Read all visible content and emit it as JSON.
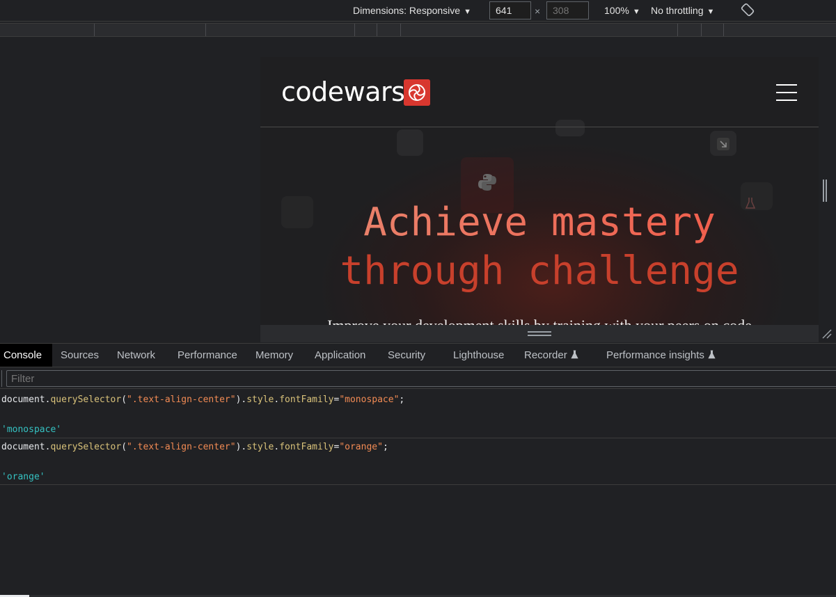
{
  "device_toolbar": {
    "dimensions_label": "Dimensions: Responsive",
    "width_value": "641",
    "height_placeholder": "308",
    "times": "×",
    "zoom": "100%",
    "throttling": "No throttling",
    "caret": "▼"
  },
  "page": {
    "logo_text": "codewars",
    "hero_line1": "Achieve mastery",
    "hero_line2": "through challenge",
    "hero_sub": "Improve your development skills by training with your peers on code",
    "brand_color": "#d8372f"
  },
  "tabs": [
    {
      "label": "Console",
      "active": true
    },
    {
      "label": "Sources"
    },
    {
      "label": "Network"
    },
    {
      "label": "Performance"
    },
    {
      "label": "Memory"
    },
    {
      "label": "Application"
    },
    {
      "label": "Security"
    },
    {
      "label": "Lighthouse"
    },
    {
      "label": "Recorder",
      "experimental": true
    },
    {
      "label": "Performance insights",
      "experimental": true
    }
  ],
  "filter": {
    "placeholder": "Filter"
  },
  "console": {
    "entries": [
      {
        "cmd_obj": "document",
        "cmd_dot1": ".",
        "cmd_method": "querySelector",
        "cmd_open": "(",
        "cmd_arg": "\".text-align-center\"",
        "cmd_close": ").",
        "cmd_prop1": "style",
        "cmd_dot2": ".",
        "cmd_prop2": "fontFamily",
        "cmd_eq": "=",
        "cmd_value": "\"monospace\"",
        "cmd_end": ";",
        "result": "'monospace'"
      },
      {
        "cmd_obj": "document",
        "cmd_dot1": ".",
        "cmd_method": "querySelector",
        "cmd_open": "(",
        "cmd_arg": "\".text-align-center\"",
        "cmd_close": ").",
        "cmd_prop1": "style",
        "cmd_dot2": ".",
        "cmd_prop2": "fontFamily",
        "cmd_eq": "=",
        "cmd_value": "\"orange\"",
        "cmd_end": ";",
        "result": "'orange'"
      }
    ]
  },
  "colors": {
    "devtools_bg": "#202124",
    "string": "#f28b54",
    "result": "#35c2c2",
    "hero_accent": "#c8402c"
  }
}
